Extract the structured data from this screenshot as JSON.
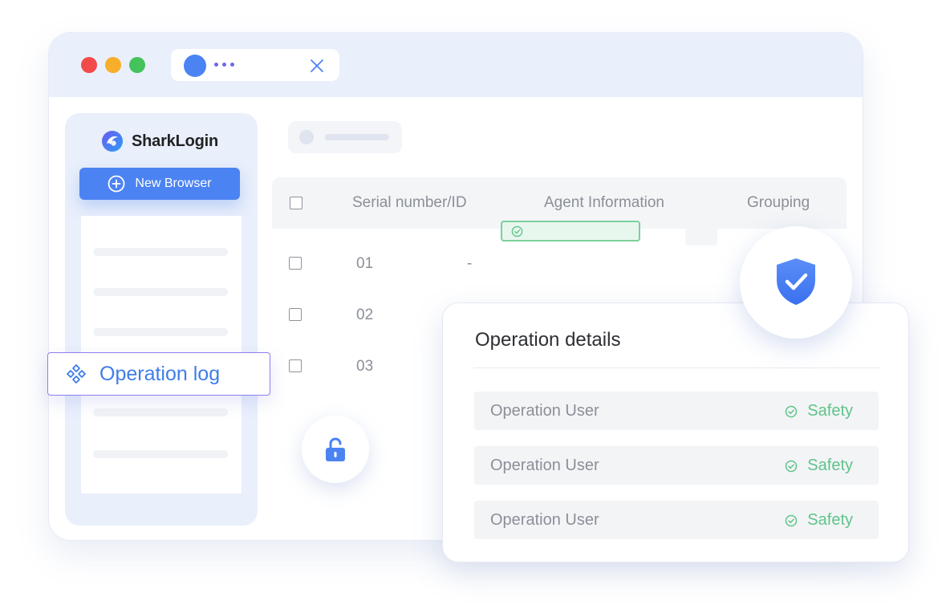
{
  "brand": {
    "name": "SharkLogin",
    "accent_color": "#4c83f3",
    "logo_icon": "shark-logo-icon"
  },
  "window": {
    "traffic_lights": [
      "#f24a4a",
      "#f7ae2a",
      "#46c25c"
    ],
    "tab_icon": "close-icon"
  },
  "sidebar": {
    "new_browser_label": "New Browser",
    "new_browser_icon": "plus-circle-icon",
    "operation_log_label": "Operation log",
    "operation_log_icon": "diamond-nodes-icon"
  },
  "table": {
    "columns": [
      "Serial number/ID",
      "Agent Information",
      "Grouping"
    ],
    "rows": [
      {
        "serial": "01",
        "id": "-"
      },
      {
        "serial": "02",
        "id": ""
      },
      {
        "serial": "03",
        "id": ""
      }
    ],
    "agent_status_icon": "check-circle-icon",
    "agent_status_color": "#5fc48a"
  },
  "details": {
    "title": "Operation details",
    "rows": [
      {
        "user": "Operation User",
        "status": "Safety"
      },
      {
        "user": "Operation User",
        "status": "Safety"
      },
      {
        "user": "Operation User",
        "status": "Safety"
      }
    ],
    "status_icon": "check-circle-icon",
    "status_color": "#5fc48a"
  },
  "badges": {
    "shield_icon": "shield-check-icon",
    "lock_icon": "unlock-icon"
  }
}
